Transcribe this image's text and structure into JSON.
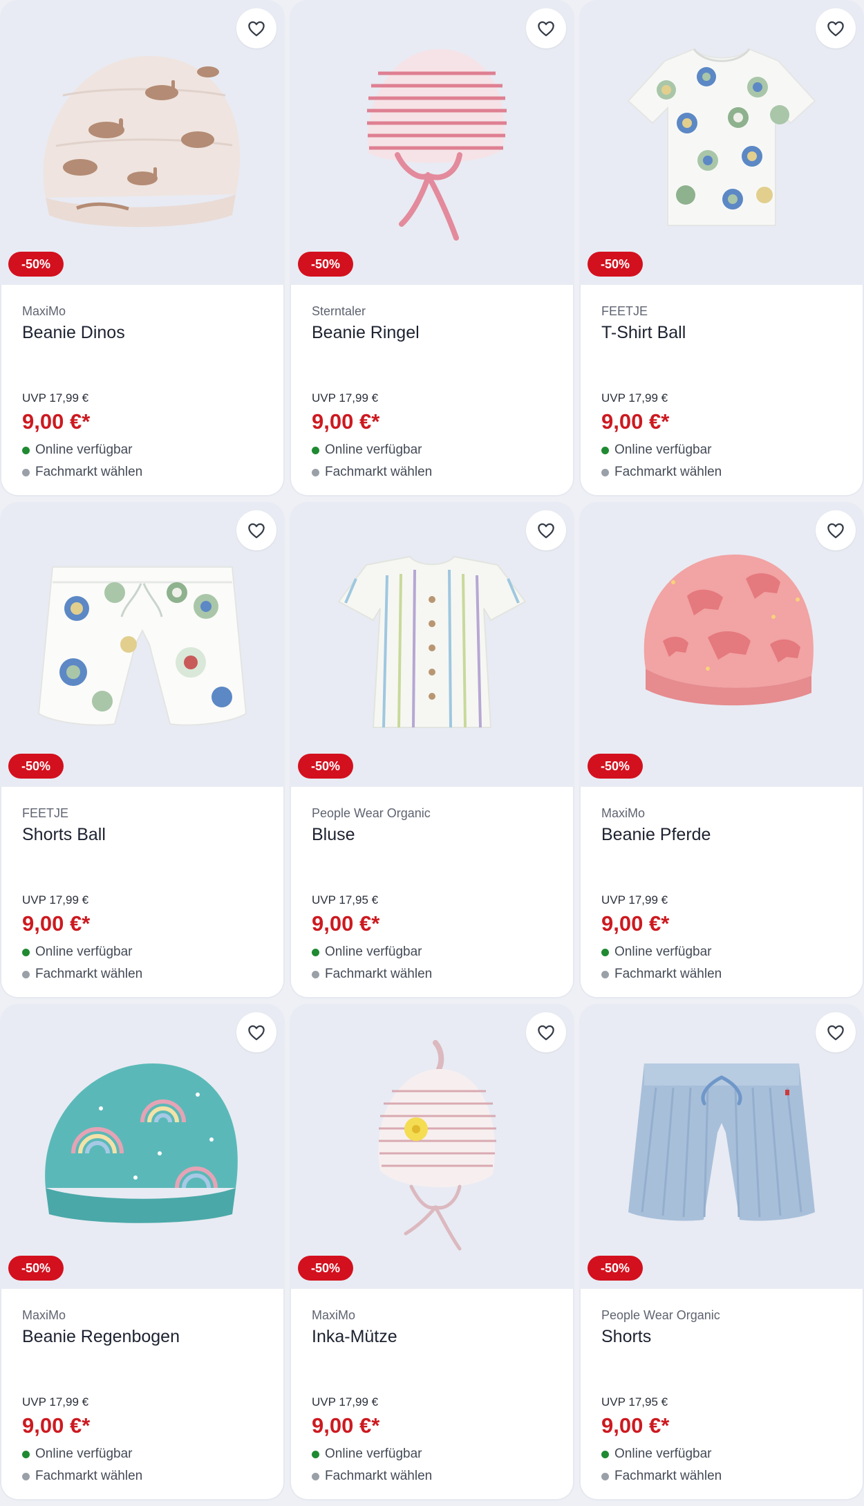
{
  "colors": {
    "badge_background": "#d3101e",
    "price_text": "#cc1a20",
    "online_dot": "#1f8a31",
    "store_dot": "#9aa0a8",
    "card_background": "#ffffff",
    "image_background": "#e8ebf3"
  },
  "products": [
    {
      "brand": "MaxiMo",
      "title": "Beanie Dinos",
      "discount": "-50%",
      "uvp": "UVP 17,99 €",
      "price": "9,00 €*",
      "online_status": "Online verfügbar",
      "store_status": "Fachmarkt wählen",
      "image": "beanie-dinos-image",
      "favorite_icon": "heart-outline-icon"
    },
    {
      "brand": "Sterntaler",
      "title": "Beanie Ringel",
      "discount": "-50%",
      "uvp": "UVP 17,99 €",
      "price": "9,00 €*",
      "online_status": "Online verfügbar",
      "store_status": "Fachmarkt wählen",
      "image": "beanie-ringel-image",
      "favorite_icon": "heart-outline-icon"
    },
    {
      "brand": "FEETJE",
      "title": "T-Shirt Ball",
      "discount": "-50%",
      "uvp": "UVP 17,99 €",
      "price": "9,00 €*",
      "online_status": "Online verfügbar",
      "store_status": "Fachmarkt wählen",
      "image": "tshirt-ball-image",
      "favorite_icon": "heart-outline-icon"
    },
    {
      "brand": "FEETJE",
      "title": "Shorts Ball",
      "discount": "-50%",
      "uvp": "UVP 17,99 €",
      "price": "9,00 €*",
      "online_status": "Online verfügbar",
      "store_status": "Fachmarkt wählen",
      "image": "shorts-ball-image",
      "favorite_icon": "heart-outline-icon"
    },
    {
      "brand": "People Wear Organic",
      "title": "Bluse",
      "discount": "-50%",
      "uvp": "UVP 17,95 €",
      "price": "9,00 €*",
      "online_status": "Online verfügbar",
      "store_status": "Fachmarkt wählen",
      "image": "bluse-image",
      "favorite_icon": "heart-outline-icon"
    },
    {
      "brand": "MaxiMo",
      "title": "Beanie Pferde",
      "discount": "-50%",
      "uvp": "UVP 17,99 €",
      "price": "9,00 €*",
      "online_status": "Online verfügbar",
      "store_status": "Fachmarkt wählen",
      "image": "beanie-pferde-image",
      "favorite_icon": "heart-outline-icon"
    },
    {
      "brand": "MaxiMo",
      "title": "Beanie Regenbogen",
      "discount": "-50%",
      "uvp": "UVP 17,99 €",
      "price": "9,00 €*",
      "online_status": "Online verfügbar",
      "store_status": "Fachmarkt wählen",
      "image": "beanie-regenbogen-image",
      "favorite_icon": "heart-outline-icon"
    },
    {
      "brand": "MaxiMo",
      "title": "Inka-Mütze",
      "discount": "-50%",
      "uvp": "UVP 17,99 €",
      "price": "9,00 €*",
      "online_status": "Online verfügbar",
      "store_status": "Fachmarkt wählen",
      "image": "inka-muetze-image",
      "favorite_icon": "heart-outline-icon"
    },
    {
      "brand": "People Wear Organic",
      "title": "Shorts",
      "discount": "-50%",
      "uvp": "UVP 17,95 €",
      "price": "9,00 €*",
      "online_status": "Online verfügbar",
      "store_status": "Fachmarkt wählen",
      "image": "shorts-image",
      "favorite_icon": "heart-outline-icon"
    }
  ]
}
